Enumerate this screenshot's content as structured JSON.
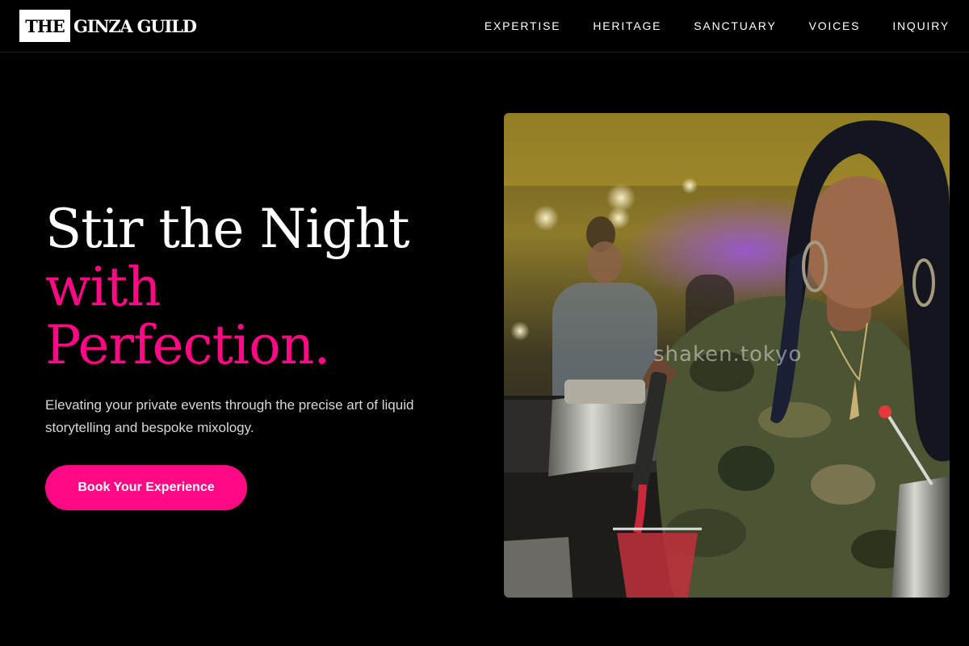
{
  "brand": {
    "logo_box_text": "THE",
    "logo_text": "GINZA GUILD"
  },
  "nav": {
    "items": [
      "EXPERTISE",
      "HERITAGE",
      "SANCTUARY",
      "VOICES",
      "INQUIRY"
    ]
  },
  "hero": {
    "title_line1": "Stir the Night",
    "title_line2": "with",
    "title_line3": "Perfection.",
    "subtitle": "Elevating your private events through the precise art of liquid storytelling and bespoke mixology.",
    "cta_label": "Book Your Experience",
    "image_watermark": "shaken.tokyo"
  },
  "colors": {
    "background": "#000000",
    "accent": "#ff0a84",
    "text": "#ffffff"
  }
}
